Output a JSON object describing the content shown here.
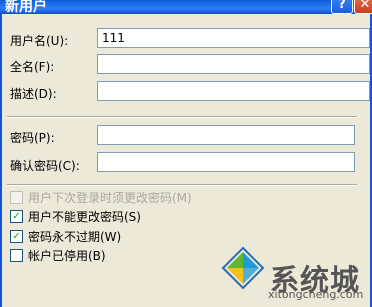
{
  "window": {
    "title": "新用户",
    "help_label": "?",
    "close_label": "✕"
  },
  "form": {
    "username_label": "用户名(U):",
    "username_value": "111",
    "fullname_label": "全名(F):",
    "fullname_value": "",
    "description_label": "描述(D):",
    "description_value": "",
    "password_label": "密码(P):",
    "confirm_label": "确认密码(C):"
  },
  "options": [
    {
      "label": "用户下次登录时须更改密码(M)",
      "checked": false,
      "disabled": true,
      "mark": ""
    },
    {
      "label": "用户不能更改密码(S)",
      "checked": true,
      "disabled": false,
      "mark": "✓"
    },
    {
      "label": "密码永不过期(W)",
      "checked": true,
      "disabled": false,
      "mark": "✓"
    },
    {
      "label": "帐户已停用(B)",
      "checked": false,
      "disabled": false,
      "mark": ""
    }
  ],
  "watermark": {
    "brand": "系统城",
    "url": "xitongcheng.com",
    "colors": {
      "blue": "#1d9bd8",
      "green": "#5db82e",
      "yellow": "#f2c21b",
      "dark": "#2b6cb0"
    }
  }
}
